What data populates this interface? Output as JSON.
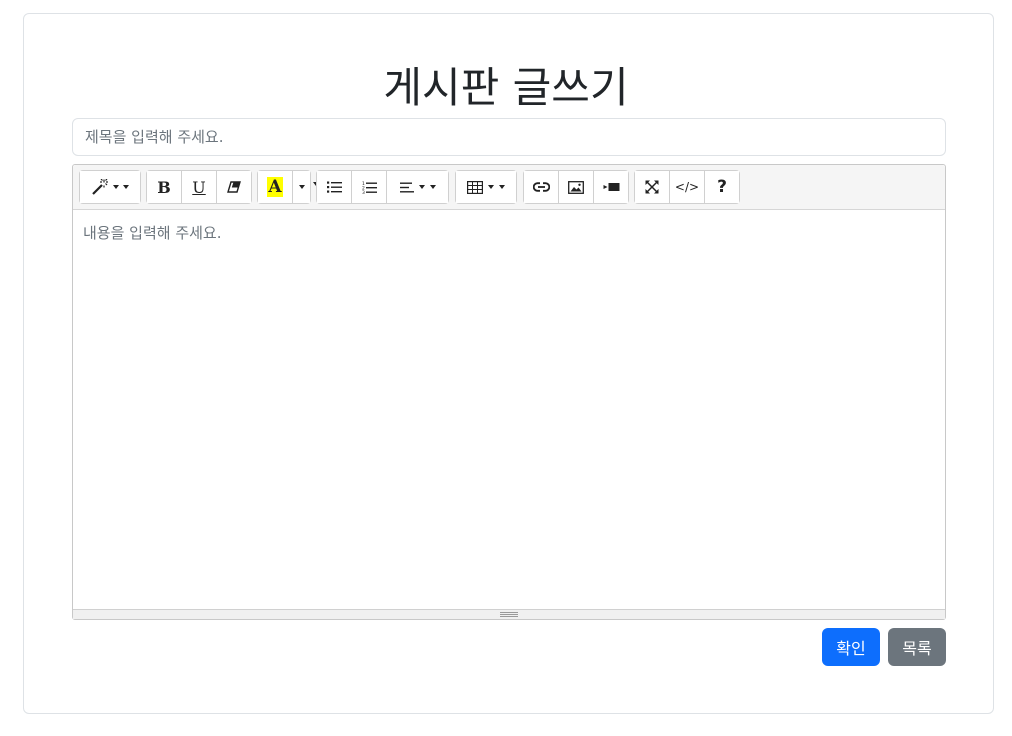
{
  "page": {
    "title": "게시판 글쓰기"
  },
  "form": {
    "title_placeholder": "제목을 입력해 주세요.",
    "title_value": "",
    "content_placeholder": "내용을 입력해 주세요."
  },
  "toolbar": {
    "groups": [
      {
        "name": "style",
        "buttons": [
          "magic-wand-icon"
        ]
      },
      {
        "name": "font",
        "buttons": [
          "bold-icon",
          "underline-icon",
          "eraser-icon"
        ]
      },
      {
        "name": "color",
        "buttons": [
          "text-color-icon",
          "color-dropdown"
        ]
      },
      {
        "name": "para",
        "buttons": [
          "unordered-list-icon",
          "ordered-list-icon",
          "align-icon"
        ]
      },
      {
        "name": "table",
        "buttons": [
          "table-icon"
        ]
      },
      {
        "name": "insert",
        "buttons": [
          "link-icon",
          "picture-icon",
          "video-icon"
        ]
      },
      {
        "name": "view",
        "buttons": [
          "fullscreen-icon",
          "codeview-icon",
          "help-icon"
        ]
      }
    ],
    "bold_label": "B",
    "underline_label": "U",
    "color_label": "A",
    "codeview_label": "</>",
    "help_label": "?",
    "highlight_color": "#ffff00"
  },
  "actions": {
    "confirm_label": "확인",
    "list_label": "목록",
    "primary_color": "#0d6efd",
    "secondary_color": "#6c757d"
  }
}
